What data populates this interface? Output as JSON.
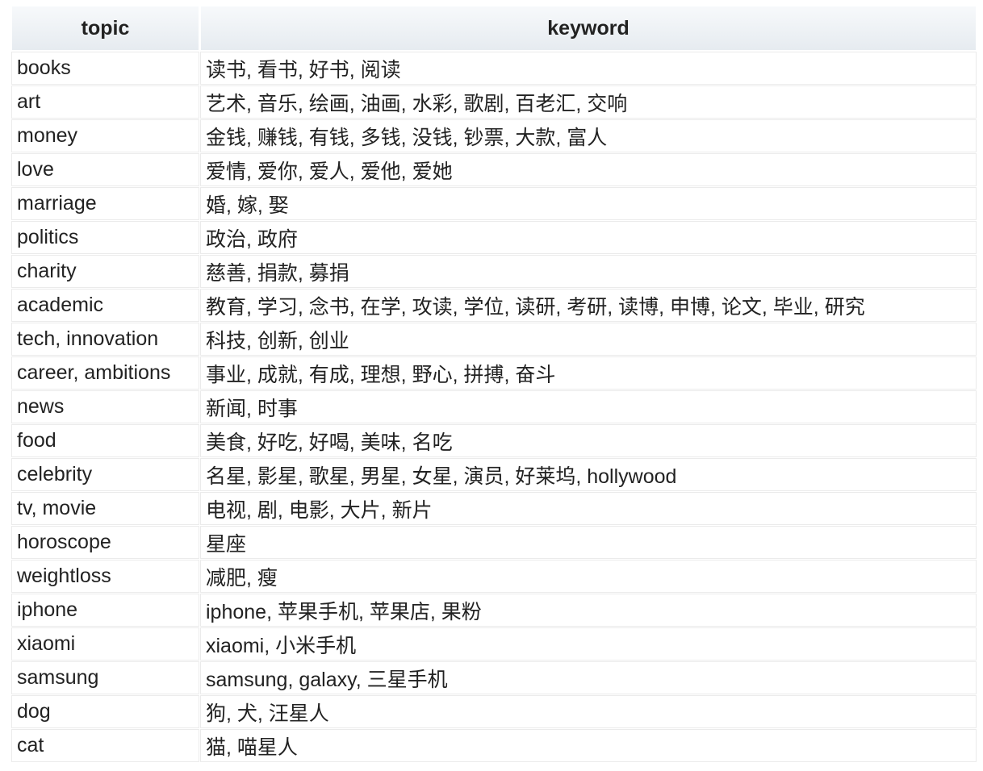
{
  "table": {
    "headers": [
      "topic",
      "keyword"
    ],
    "rows": [
      {
        "topic": "books",
        "keyword": "读书, 看书, 好书, 阅读"
      },
      {
        "topic": "art",
        "keyword": "艺术, 音乐, 绘画, 油画, 水彩, 歌剧, 百老汇, 交响"
      },
      {
        "topic": "money",
        "keyword": "金钱, 赚钱, 有钱, 多钱, 没钱, 钞票, 大款, 富人"
      },
      {
        "topic": "love",
        "keyword": "爱情, 爱你, 爱人, 爱他, 爱她"
      },
      {
        "topic": "marriage",
        "keyword": "婚, 嫁, 娶"
      },
      {
        "topic": "politics",
        "keyword": "政治, 政府"
      },
      {
        "topic": "charity",
        "keyword": "慈善, 捐款, 募捐"
      },
      {
        "topic": "academic",
        "keyword": "教育, 学习, 念书, 在学, 攻读, 学位, 读研, 考研, 读博, 申博, 论文, 毕业, 研究"
      },
      {
        "topic": "tech, innovation",
        "keyword": "科技, 创新, 创业"
      },
      {
        "topic": "career, ambitions",
        "keyword": "事业, 成就, 有成, 理想, 野心, 拼搏, 奋斗"
      },
      {
        "topic": "news",
        "keyword": "新闻, 时事"
      },
      {
        "topic": "food",
        "keyword": "美食, 好吃, 好喝, 美味, 名吃"
      },
      {
        "topic": "celebrity",
        "keyword": "名星, 影星, 歌星, 男星, 女星, 演员, 好莱坞, hollywood"
      },
      {
        "topic": "tv, movie",
        "keyword": "电视, 剧, 电影, 大片, 新片"
      },
      {
        "topic": "horoscope",
        "keyword": "星座"
      },
      {
        "topic": "weightloss",
        "keyword": "减肥, 瘦"
      },
      {
        "topic": "iphone",
        "keyword": "iphone, 苹果手机, 苹果店, 果粉"
      },
      {
        "topic": "xiaomi",
        "keyword": "xiaomi, 小米手机"
      },
      {
        "topic": "samsung",
        "keyword": "samsung, galaxy, 三星手机"
      },
      {
        "topic": "dog",
        "keyword": "狗, 犬, 汪星人"
      },
      {
        "topic": "cat",
        "keyword": "猫, 喵星人"
      }
    ]
  }
}
